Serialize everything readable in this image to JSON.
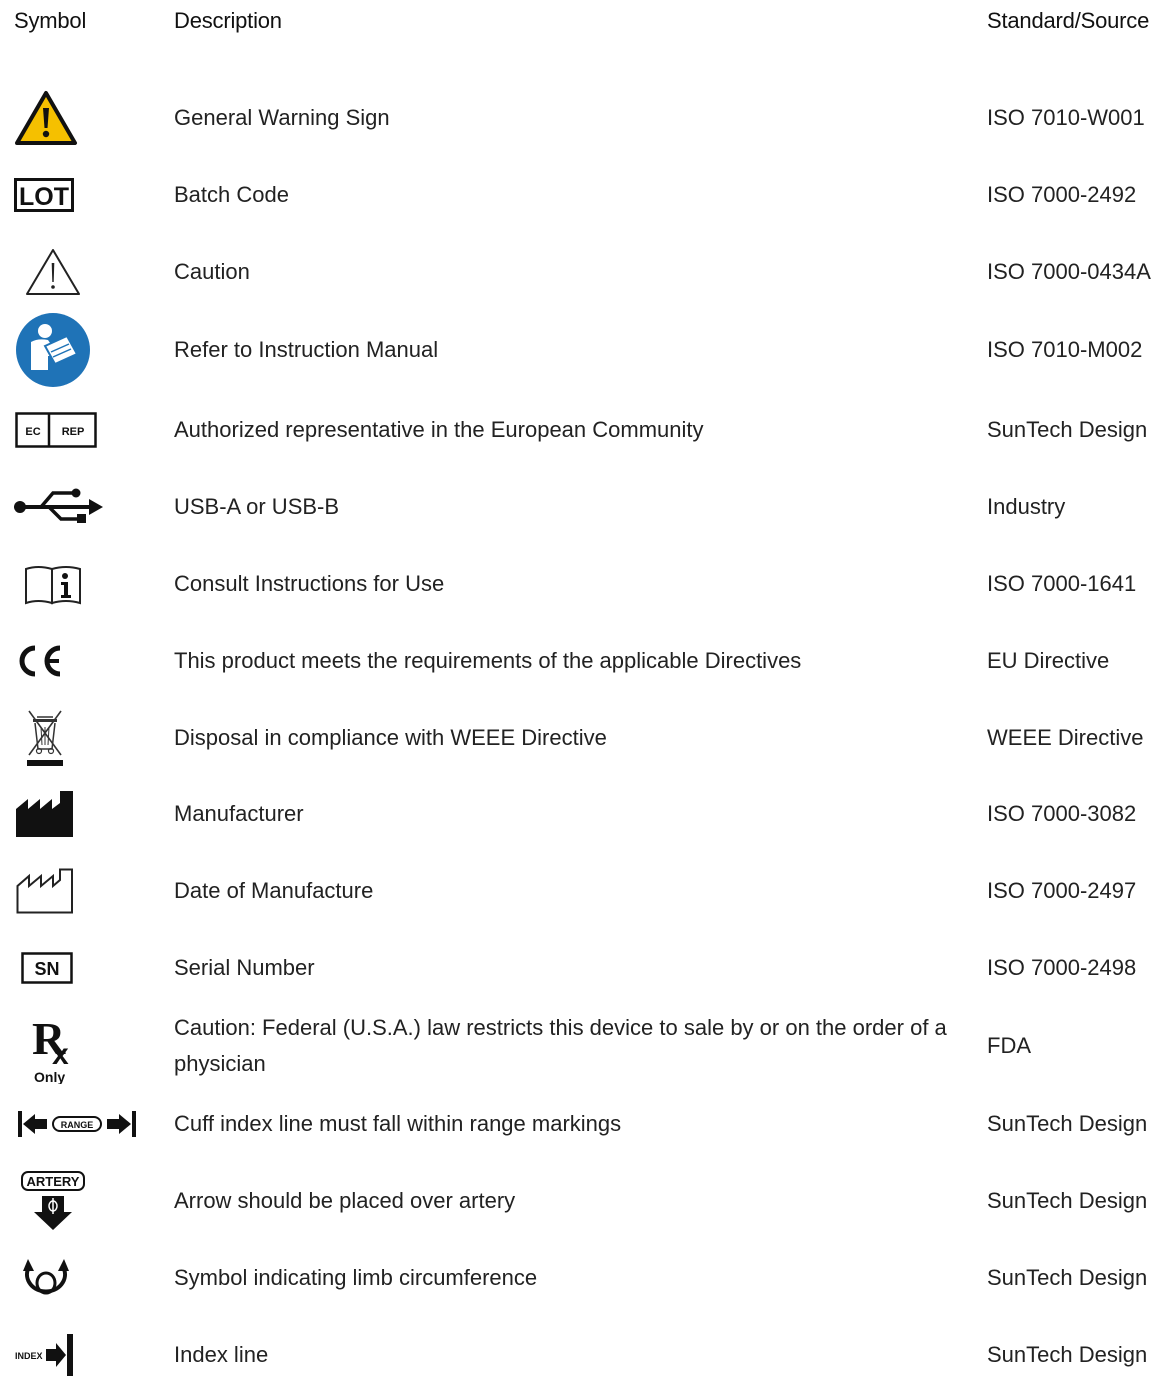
{
  "header": {
    "symbol": "Symbol",
    "description": "Description",
    "standard": "Standard/Source"
  },
  "rows": [
    {
      "icon": "general-warning-icon",
      "description": "General Warning Sign",
      "standard": "ISO 7010-W001"
    },
    {
      "icon": "lot-icon",
      "icon_text": "LOT",
      "description": "Batch Code",
      "standard": "ISO 7000-2492"
    },
    {
      "icon": "caution-icon",
      "description": "Caution",
      "standard": "ISO 7000-0434A"
    },
    {
      "icon": "instruction-manual-icon",
      "description": "Refer to Instruction Manual",
      "standard": "ISO 7010-M002"
    },
    {
      "icon": "ec-rep-icon",
      "icon_text_1": "EC",
      "icon_text_2": "REP",
      "description": "Authorized representative in the European Community",
      "standard": "SunTech Design"
    },
    {
      "icon": "usb-icon",
      "description": "USB-A or USB-B",
      "standard": "Industry"
    },
    {
      "icon": "consult-instructions-icon",
      "description": "Consult Instructions for Use",
      "standard": "ISO 7000-1641"
    },
    {
      "icon": "ce-mark-icon",
      "icon_text": "CE",
      "description": "This product meets the requirements of the applicable Directives",
      "standard": "EU Directive"
    },
    {
      "icon": "weee-bin-icon",
      "description": "Disposal in compliance with WEEE Directive",
      "standard": "WEEE Directive"
    },
    {
      "icon": "manufacturer-icon",
      "description": "Manufacturer",
      "standard": "ISO 7000-3082"
    },
    {
      "icon": "date-of-manufacture-icon",
      "description": "Date of Manufacture",
      "standard": "ISO 7000-2497"
    },
    {
      "icon": "serial-number-icon",
      "icon_text": "SN",
      "description": "Serial Number",
      "standard": "ISO 7000-2498"
    },
    {
      "icon": "rx-only-icon",
      "icon_text_1": "R",
      "icon_text_2": "x",
      "icon_text_3": "Only",
      "description": "Caution: Federal (U.S.A.) law restricts this device to sale by or on the order of a physician",
      "standard": "FDA"
    },
    {
      "icon": "range-icon",
      "icon_text": "RANGE",
      "description": "Cuff index line must fall within range markings",
      "standard": "SunTech Design"
    },
    {
      "icon": "artery-icon",
      "icon_text": "ARTERY",
      "description": "Arrow should be placed over artery",
      "standard": "SunTech Design"
    },
    {
      "icon": "limb-circumference-icon",
      "description": "Symbol indicating limb circumference",
      "standard": "SunTech Design"
    },
    {
      "icon": "index-line-icon",
      "icon_text": "INDEX",
      "description": "Index line",
      "standard": "SunTech Design"
    }
  ]
}
